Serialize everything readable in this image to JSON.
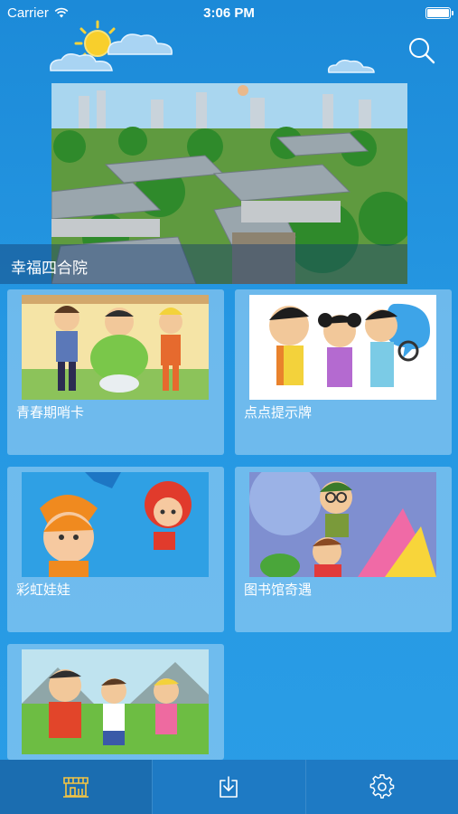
{
  "status": {
    "carrier": "Carrier",
    "time": "3:06 PM"
  },
  "banner": {
    "caption": "幸福四合院"
  },
  "cards": [
    {
      "title": "青春期哨卡"
    },
    {
      "title": "点点提示牌"
    },
    {
      "title": "彩虹娃娃"
    },
    {
      "title": "图书馆奇遇"
    },
    {
      "title": ""
    }
  ],
  "tabs": [
    {
      "icon": "shop-icon",
      "active": true
    },
    {
      "icon": "download-icon",
      "active": false
    },
    {
      "icon": "gear-icon",
      "active": false
    }
  ],
  "colors": {
    "background": "#2597e2",
    "tab_bar": "#1e7ac4",
    "card": "#aad7f5"
  }
}
